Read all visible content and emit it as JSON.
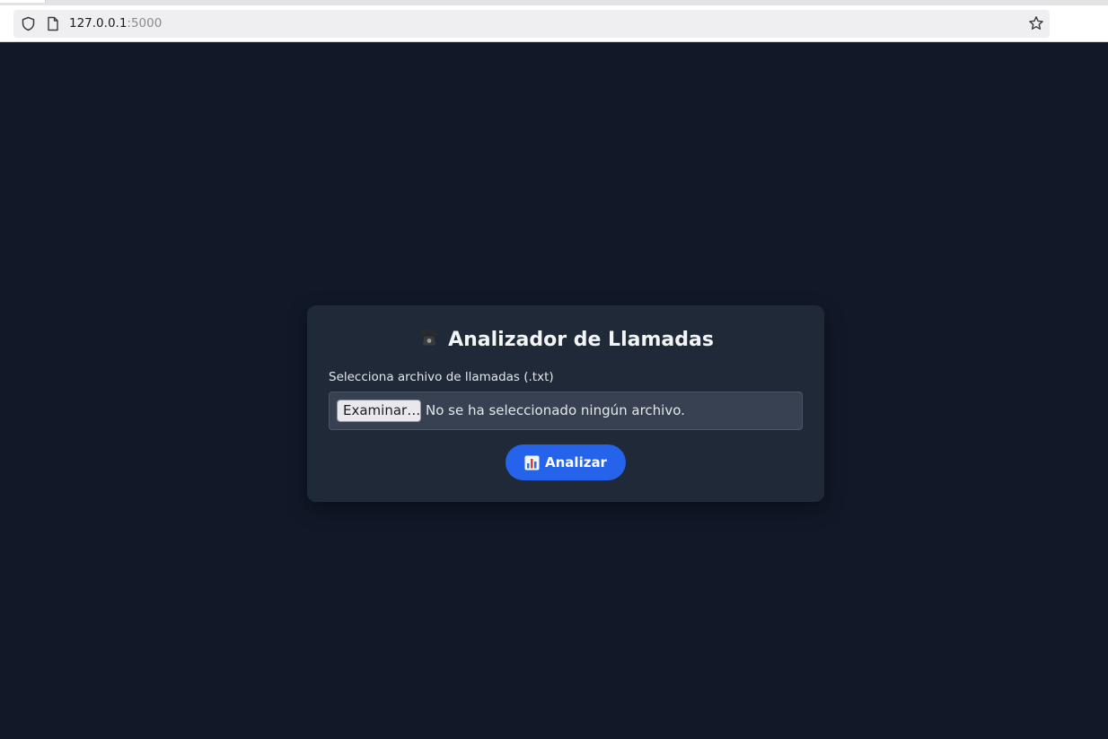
{
  "browser": {
    "url_host": "127.0.0.1",
    "url_port": ":5000",
    "icons": [
      "shield-icon",
      "page-icon",
      "star-icon"
    ]
  },
  "card": {
    "title": "Analizador de Llamadas",
    "title_icon": "phone-icon",
    "file_label": "Selecciona archivo de llamadas (.txt)",
    "browse_label": "Examinar…",
    "file_status": "No se ha seleccionado ningún archivo.",
    "analyze_label": "Analizar",
    "analyze_icon": "bar-chart-icon"
  },
  "colors": {
    "page_background": "#111827",
    "card_background": "#1f2937",
    "input_background": "#374151",
    "accent": "#2563eb"
  }
}
